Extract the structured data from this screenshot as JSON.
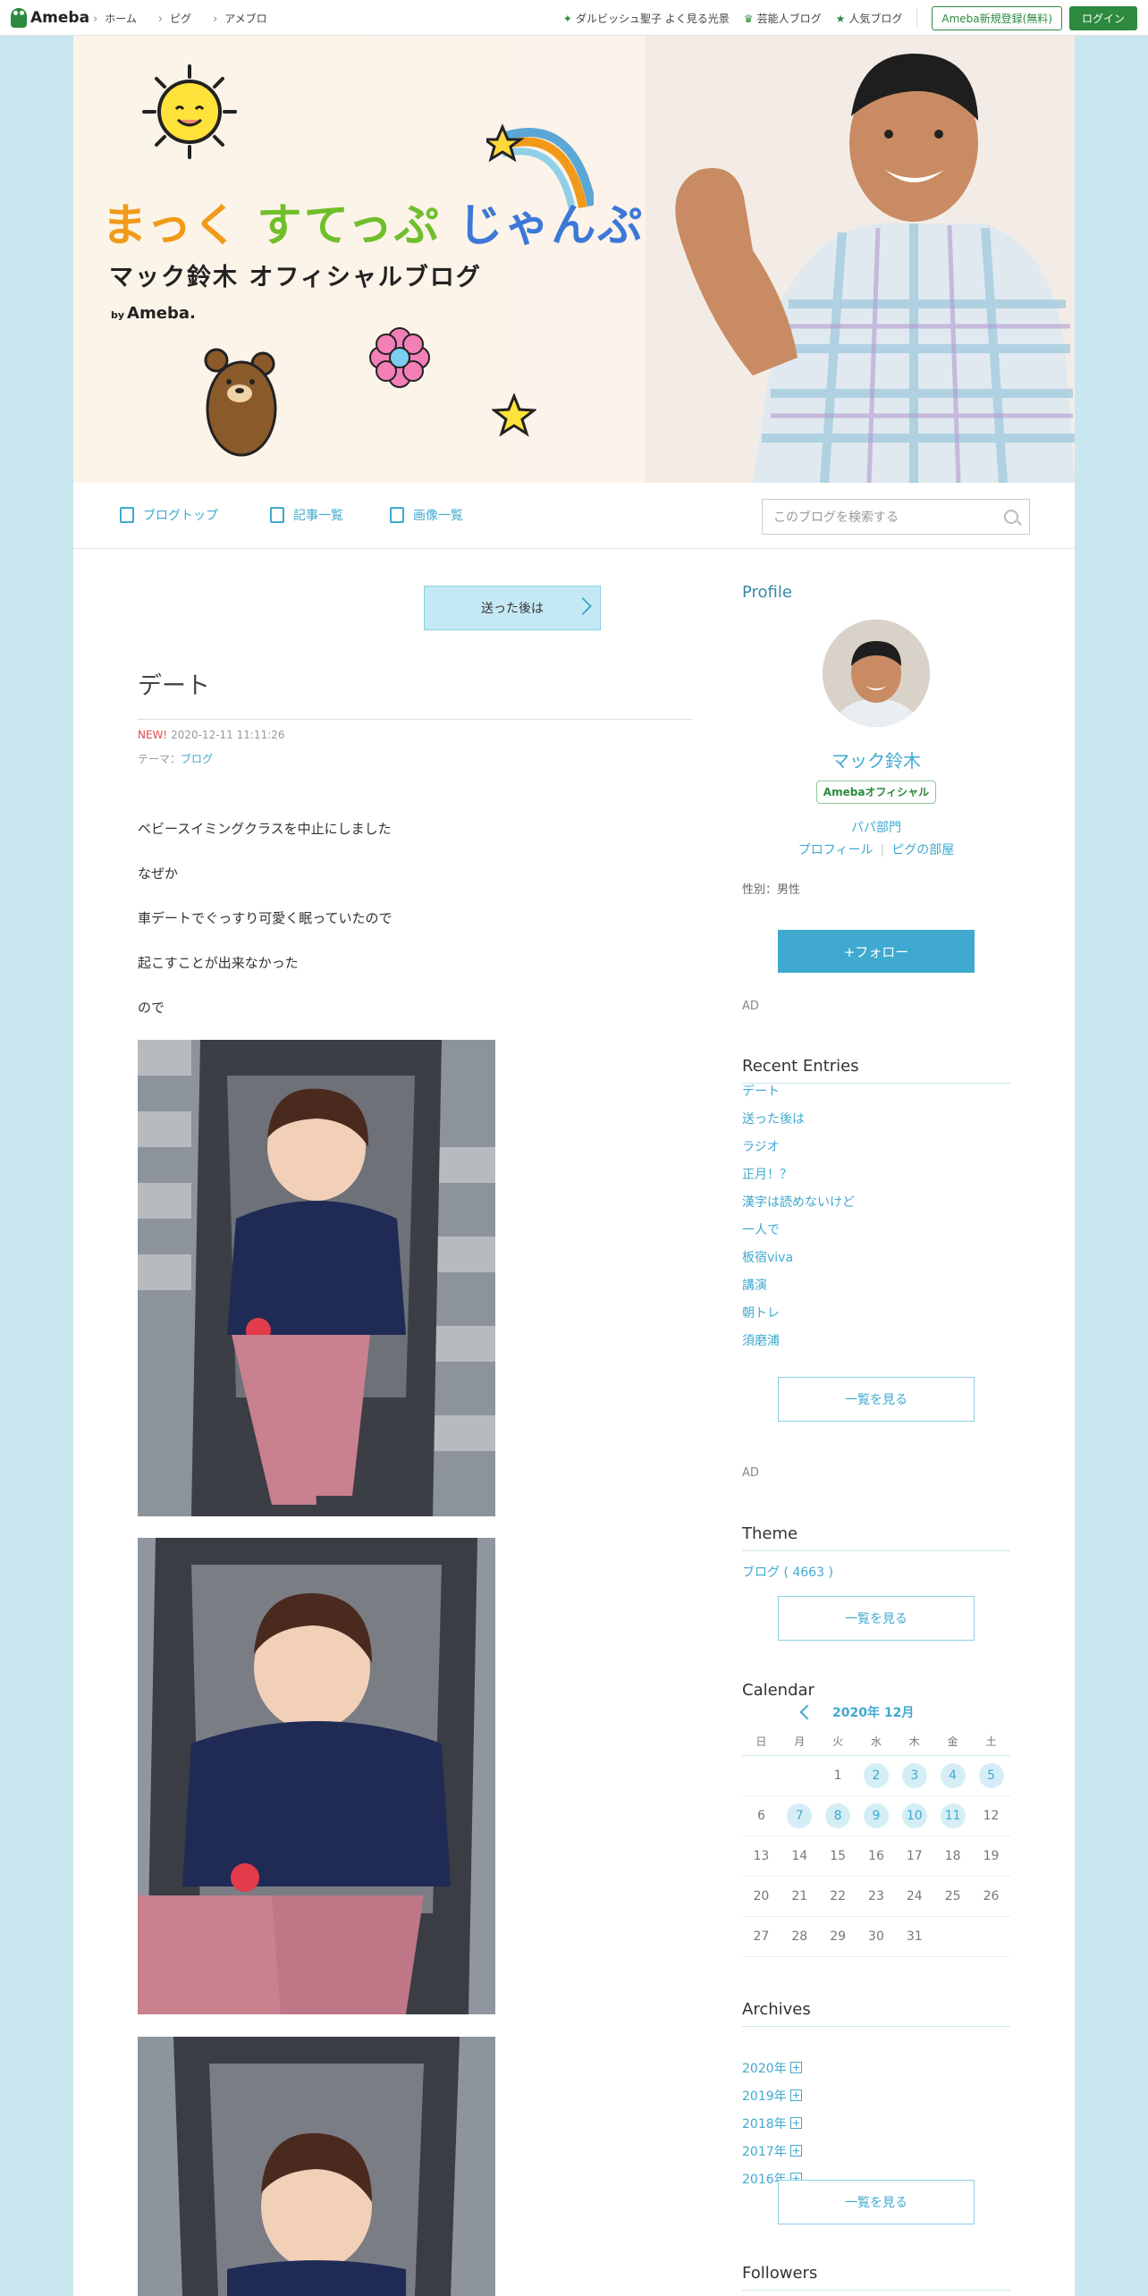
{
  "topbar": {
    "logo": "Ameba",
    "nav": [
      "ホーム",
      "ピグ",
      "アメブロ"
    ],
    "links": [
      "ダルビッシュ聖子 よく見る光景",
      "芸能人ブログ",
      "人気ブログ"
    ],
    "register": "Ameba新規登録(無料)",
    "login": "ログイン"
  },
  "banner": {
    "title_a": "まっく",
    "title_b": "すてっぷ",
    "title_c": "じゃんぷ",
    "subtitle": "マック鈴木 オフィシャルブログ",
    "by_small": "by",
    "by_brand": "Ameba."
  },
  "gnav": {
    "top": "ブログトップ",
    "list": "記事一覧",
    "images": "画像一覧",
    "search_placeholder": "このブログを検索する"
  },
  "article": {
    "prev_label": "送った後は",
    "title": "デート",
    "new_badge": "NEW!",
    "datetime": "2020-12-11 11:11:26",
    "theme_label": "テーマ：",
    "theme_value": "ブログ",
    "paragraphs": [
      "ベビースイミングクラスを中止にしました",
      "なぜか",
      "車デートでぐっすり可愛く眠っていたので",
      "起こすことが出来なかった",
      "ので"
    ]
  },
  "sidebar": {
    "profile_heading": "Profile",
    "name": "マック鈴木",
    "official_badge": "Amebaオフィシャル",
    "description": "パパ部門",
    "link_profile": "プロフィール",
    "link_pig": "ピグの部屋",
    "gender": "性別：男性",
    "follow": "+フォロー",
    "ad": "AD",
    "recent_heading": "Recent Entries",
    "recent": [
      "デート",
      "送った後は",
      "ラジオ",
      "正月！？",
      "漢字は読めないけど",
      "一人で",
      "板宿viva",
      "講演",
      "朝トレ",
      "須磨浦"
    ],
    "see_all": "一覧を見る",
    "theme_heading": "Theme",
    "theme_item": "ブログ ( 4663 )",
    "calendar_heading": "Calendar",
    "calendar_month": "2020年 12月",
    "weekdays": [
      "日",
      "月",
      "火",
      "水",
      "木",
      "金",
      "土"
    ],
    "archives_heading": "Archives",
    "archives": [
      "2020年",
      "2019年",
      "2018年",
      "2017年",
      "2016年"
    ],
    "followers_heading": "Followers"
  },
  "colors": {
    "accent": "#3fa9d0",
    "ameba_green": "#2d8a3e",
    "page_bg": "#c9e7ef",
    "new_red": "#e34c4c"
  }
}
